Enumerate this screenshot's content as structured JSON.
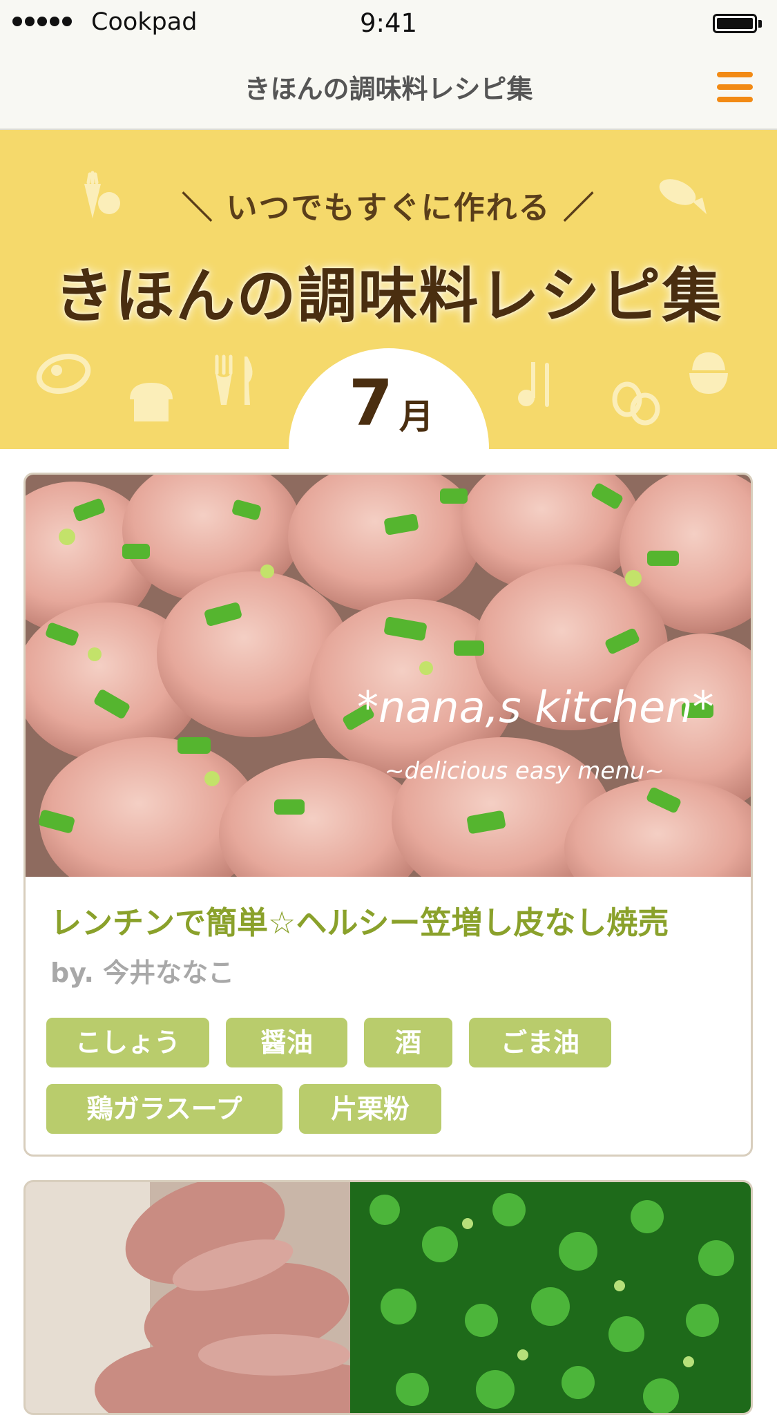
{
  "status_bar": {
    "carrier": "Cookpad",
    "time": "9:41"
  },
  "nav": {
    "title": "きほんの調味料レシピ集"
  },
  "hero": {
    "tagline": "＼ いつでもすぐに作れる ／",
    "title": "きほんの調味料レシピ集",
    "month_number": "7",
    "month_unit": "月"
  },
  "recipes": [
    {
      "photo_watermark_title": "*nana,s kitchen*",
      "photo_watermark_sub": "~delicious easy menu~",
      "title": "レンチンで簡単☆ヘルシー笠増し皮なし焼売",
      "author": "by. 今井ななこ",
      "tags": [
        "こしょう",
        "醤油",
        "酒",
        "ごま油",
        "鶏ガラスープ",
        "片栗粉"
      ]
    },
    {
      "title": "",
      "author": "",
      "tags": []
    }
  ],
  "colors": {
    "accent_orange": "#f28a14",
    "hero_yellow": "#f5d96b",
    "title_brown": "#4a2e10",
    "recipe_title_green": "#8aa12b",
    "tag_green": "#b9cc6c"
  },
  "icons": [
    "menu-icon",
    "battery-icon",
    "signal-icon"
  ]
}
